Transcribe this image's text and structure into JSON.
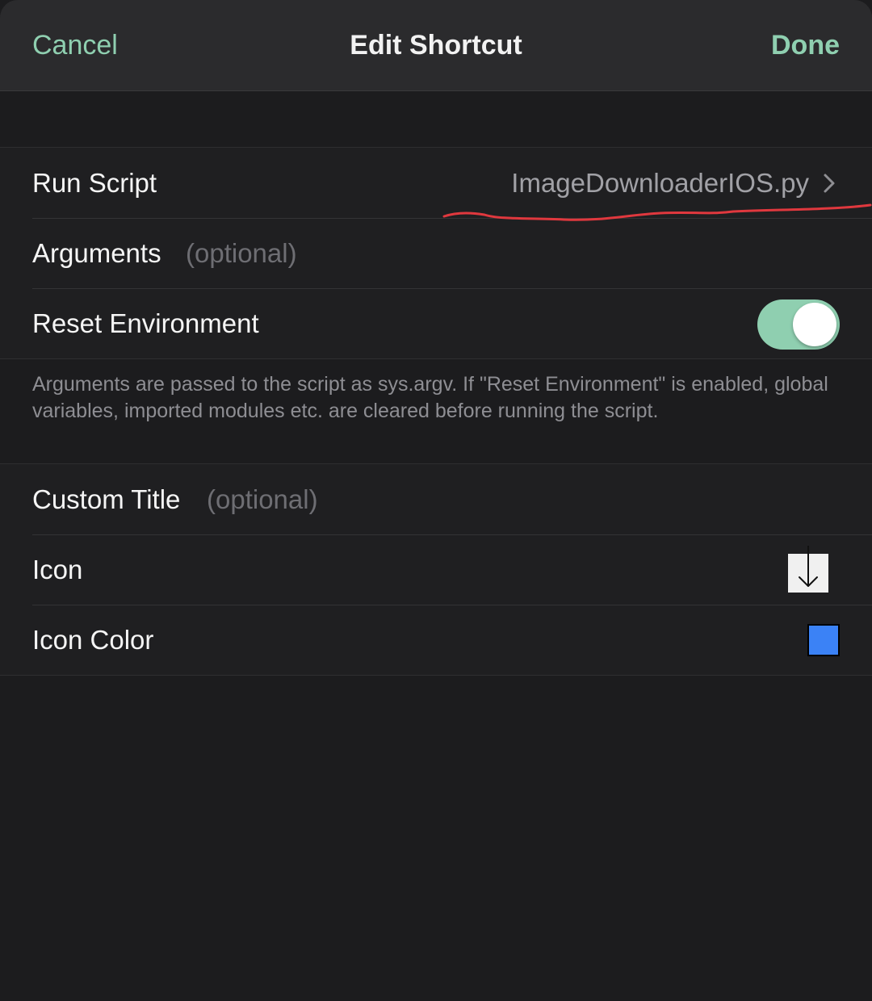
{
  "nav": {
    "cancel": "Cancel",
    "title": "Edit Shortcut",
    "done": "Done"
  },
  "rows": {
    "run_script": {
      "label": "Run Script",
      "value": "ImageDownloaderIOS.py"
    },
    "arguments": {
      "label": "Arguments",
      "placeholder": "(optional)",
      "value": ""
    },
    "reset_environment": {
      "label": "Reset Environment",
      "enabled": true
    },
    "custom_title": {
      "label": "Custom Title",
      "placeholder": "(optional)",
      "value": ""
    },
    "icon": {
      "label": "Icon",
      "icon_name": "arrow-down-icon"
    },
    "icon_color": {
      "label": "Icon Color",
      "color": "#3b82f6"
    }
  },
  "footer_note": "Arguments are passed to the script as sys.argv. If \"Reset Environment\" is enabled, global variables, imported modules etc. are cleared before running the script.",
  "colors": {
    "accent": "#8fcfb0",
    "annotation": "#e0383e",
    "icon_color": "#3b82f6"
  }
}
